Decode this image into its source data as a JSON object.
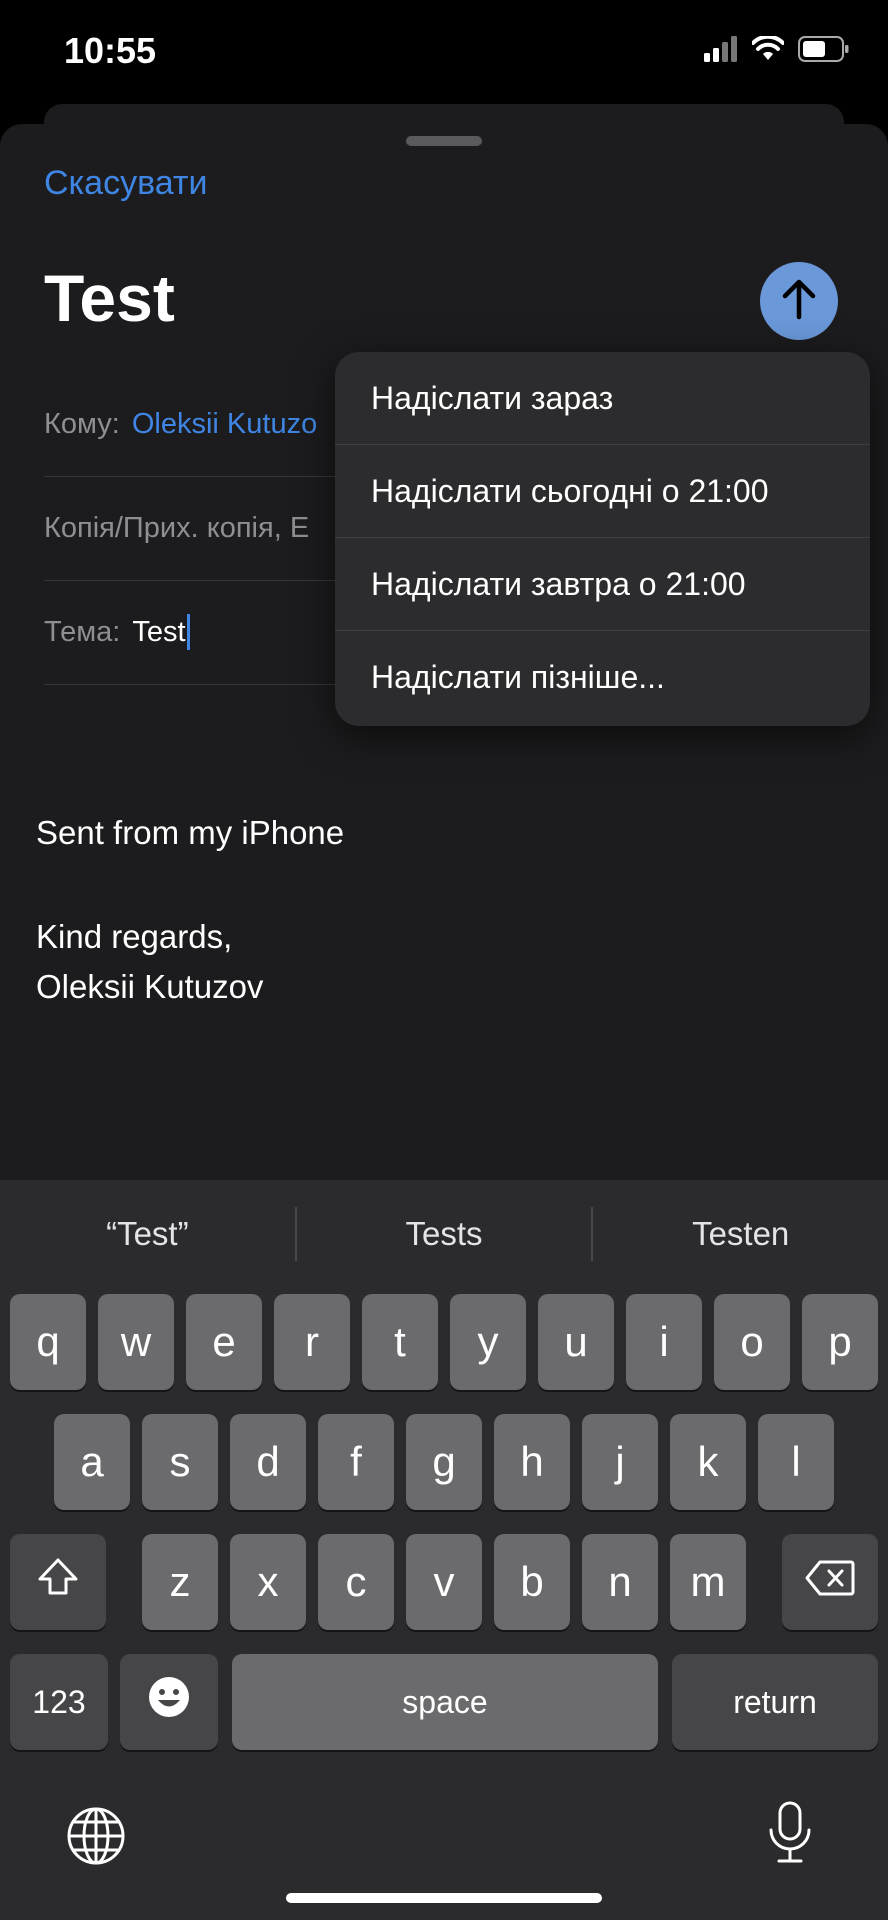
{
  "status_bar": {
    "time": "10:55",
    "icons": [
      "cellular-signal-icon",
      "wifi-icon",
      "battery-icon"
    ]
  },
  "compose": {
    "cancel_label": "Скасувати",
    "title": "Test",
    "send_icon": "arrow-up-icon",
    "fields": {
      "to_label": "Кому:",
      "to_value": "Oleksii Kutuzo",
      "cc_label": "Копія/Прих. копія, Е",
      "subject_label": "Тема:",
      "subject_value": "Test"
    },
    "body": {
      "line1": "Sent from my iPhone",
      "line2": "Kind regards,",
      "line3": "Oleksii Kutuzov"
    }
  },
  "send_menu": {
    "items": [
      "Надіслати зараз",
      "Надіслати сьогодні о 21:00",
      "Надіслати завтра о 21:00",
      "Надіслати пізніше..."
    ]
  },
  "keyboard": {
    "suggestions": [
      "“Test”",
      "Tests",
      "Testen"
    ],
    "row1": [
      "q",
      "w",
      "e",
      "r",
      "t",
      "y",
      "u",
      "i",
      "o",
      "p"
    ],
    "row2": [
      "a",
      "s",
      "d",
      "f",
      "g",
      "h",
      "j",
      "k",
      "l"
    ],
    "row3": [
      "z",
      "x",
      "c",
      "v",
      "b",
      "n",
      "m"
    ],
    "numbers_label": "123",
    "space_label": "space",
    "return_label": "return",
    "icons": {
      "shift": "shift-icon",
      "delete": "delete-icon",
      "emoji": "emoji-icon",
      "globe": "globe-icon",
      "mic": "microphone-icon"
    }
  },
  "colors": {
    "accent": "#3f85e3",
    "send_button": "#6a98d9",
    "sheet_background": "#1c1c1e",
    "menu_background": "#2c2c2e",
    "keyboard_background": "#2b2b2d"
  }
}
